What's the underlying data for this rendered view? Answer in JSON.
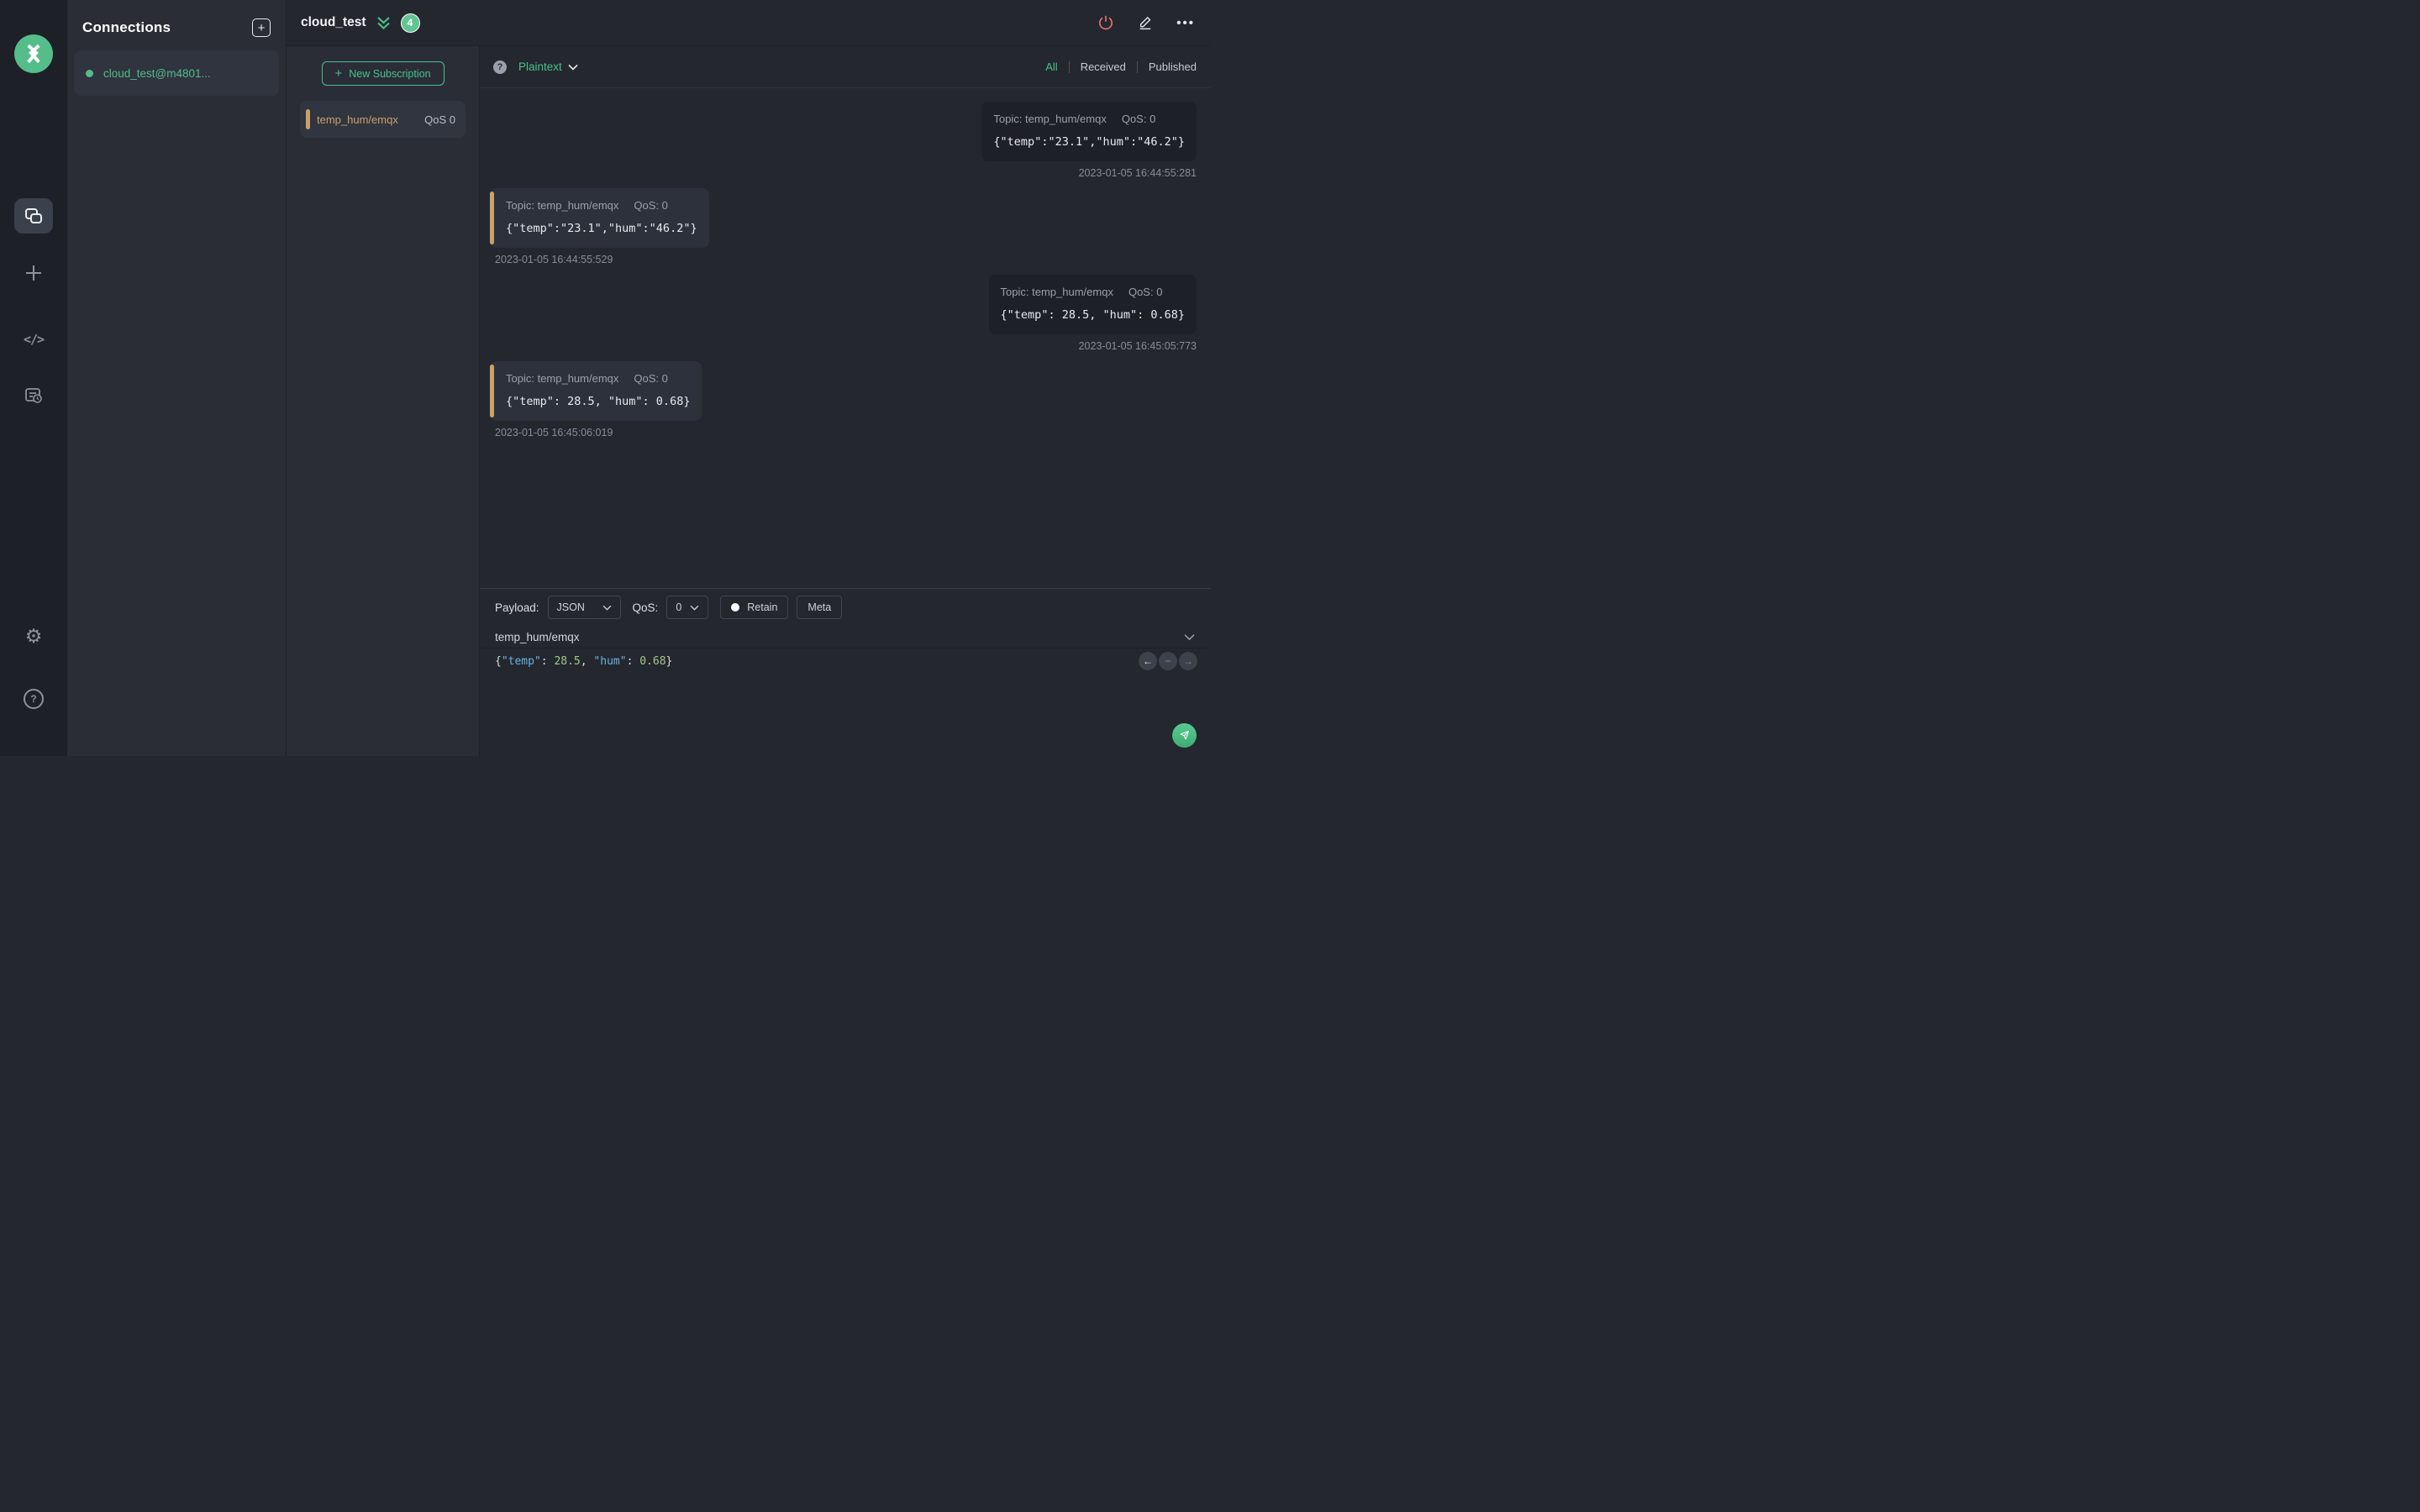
{
  "colors": {
    "accent_green": "#46c28a",
    "accent_tan": "#c9a16b",
    "danger_red": "#e9726f",
    "badge_green": "#63c494",
    "code_key_blue": "#6cb1e1",
    "code_num_green": "#a3c98a"
  },
  "connections_panel": {
    "title": "Connections",
    "connection": {
      "name": "cloud_test@m4801...",
      "status": "connected"
    }
  },
  "header": {
    "title": "cloud_test",
    "badge_count": "4"
  },
  "subscriptions": {
    "new_button": "New Subscription",
    "items": [
      {
        "topic": "temp_hum/emqx",
        "qos": "QoS 0"
      }
    ]
  },
  "toolbar": {
    "format": "Plaintext",
    "help": "?",
    "active_filter": "All",
    "filters": [
      "All",
      "Received",
      "Published"
    ]
  },
  "messages": [
    {
      "direction": "published",
      "topic": "Topic: temp_hum/emqx",
      "qos": "QoS: 0",
      "payload": "{\"temp\":\"23.1\",\"hum\":\"46.2\"}",
      "timestamp": "2023-01-05 16:44:55:281"
    },
    {
      "direction": "received",
      "topic": "Topic: temp_hum/emqx",
      "qos": "QoS: 0",
      "payload": "{\"temp\":\"23.1\",\"hum\":\"46.2\"}",
      "timestamp": "2023-01-05 16:44:55:529"
    },
    {
      "direction": "published",
      "topic": "Topic: temp_hum/emqx",
      "qos": "QoS: 0",
      "payload": "{\"temp\": 28.5, \"hum\": 0.68}",
      "timestamp": "2023-01-05 16:45:05:773"
    },
    {
      "direction": "received",
      "topic": "Topic: temp_hum/emqx",
      "qos": "QoS: 0",
      "payload": "{\"temp\": 28.5, \"hum\": 0.68}",
      "timestamp": "2023-01-05 16:45:06:019"
    }
  ],
  "publish": {
    "payload_label": "Payload:",
    "format": "JSON",
    "qos_label": "QoS:",
    "qos": "0",
    "retain_label": "Retain",
    "meta_label": "Meta",
    "topic": "temp_hum/emqx",
    "payload_tokens": [
      {
        "text": "{",
        "cls": "p"
      },
      {
        "text": "\"temp\"",
        "cls": "k"
      },
      {
        "text": ": ",
        "cls": "p"
      },
      {
        "text": "28.5",
        "cls": "n"
      },
      {
        "text": ", ",
        "cls": "p"
      },
      {
        "text": "\"hum\"",
        "cls": "k"
      },
      {
        "text": ": ",
        "cls": "p"
      },
      {
        "text": "0.68",
        "cls": "n"
      },
      {
        "text": "}",
        "cls": "p"
      }
    ]
  }
}
